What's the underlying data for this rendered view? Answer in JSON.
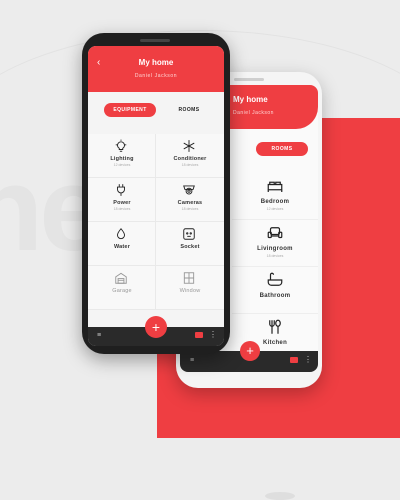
{
  "colors": {
    "accent": "#ef3e42",
    "dark": "#2a2a2a",
    "background": "#ececec"
  },
  "front": {
    "header": {
      "title": "My home",
      "subtitle": "Daniel Jackson",
      "back_icon": "chevron-left-icon"
    },
    "tabs": {
      "equipment": "EQUIPMENT",
      "rooms": "ROOMS"
    },
    "tiles": [
      {
        "label": "Lighting",
        "sub": "12 devices",
        "icon": "bulb-icon"
      },
      {
        "label": "Conditioner",
        "sub": "18 devices",
        "icon": "snowflake-icon"
      },
      {
        "label": "Power",
        "sub": "18 devices",
        "icon": "plug-icon"
      },
      {
        "label": "Cameras",
        "sub": "18 devices",
        "icon": "camera-icon"
      },
      {
        "label": "Water",
        "sub": "",
        "icon": "drop-icon"
      },
      {
        "label": "Socket",
        "sub": "",
        "icon": "socket-icon"
      },
      {
        "label": "Garage",
        "sub": "",
        "icon": "garage-icon"
      },
      {
        "label": "Window",
        "sub": "",
        "icon": "window-icon"
      }
    ],
    "fab": "+",
    "bottom": {
      "menu_icon": "≡",
      "more_icon": "⋮"
    }
  },
  "back": {
    "header": {
      "title": "My home",
      "subtitle": "Daniel Jackson"
    },
    "tabs": {
      "equipment": "NT",
      "rooms": "ROOMS"
    },
    "rooms": [
      {
        "label": "Bedroom",
        "sub": "12 devices",
        "icon": "bed-icon"
      },
      {
        "label": "Livingroom",
        "sub": "18 devices",
        "icon": "armchair-icon"
      },
      {
        "label": "Bathroom",
        "sub": "",
        "icon": "bathtub-icon"
      },
      {
        "label": "Kitchen",
        "sub": "",
        "icon": "fork-spoon-icon"
      }
    ],
    "fab": "+",
    "bottom": {
      "menu_icon": "≡",
      "more_icon": "⋮"
    }
  }
}
